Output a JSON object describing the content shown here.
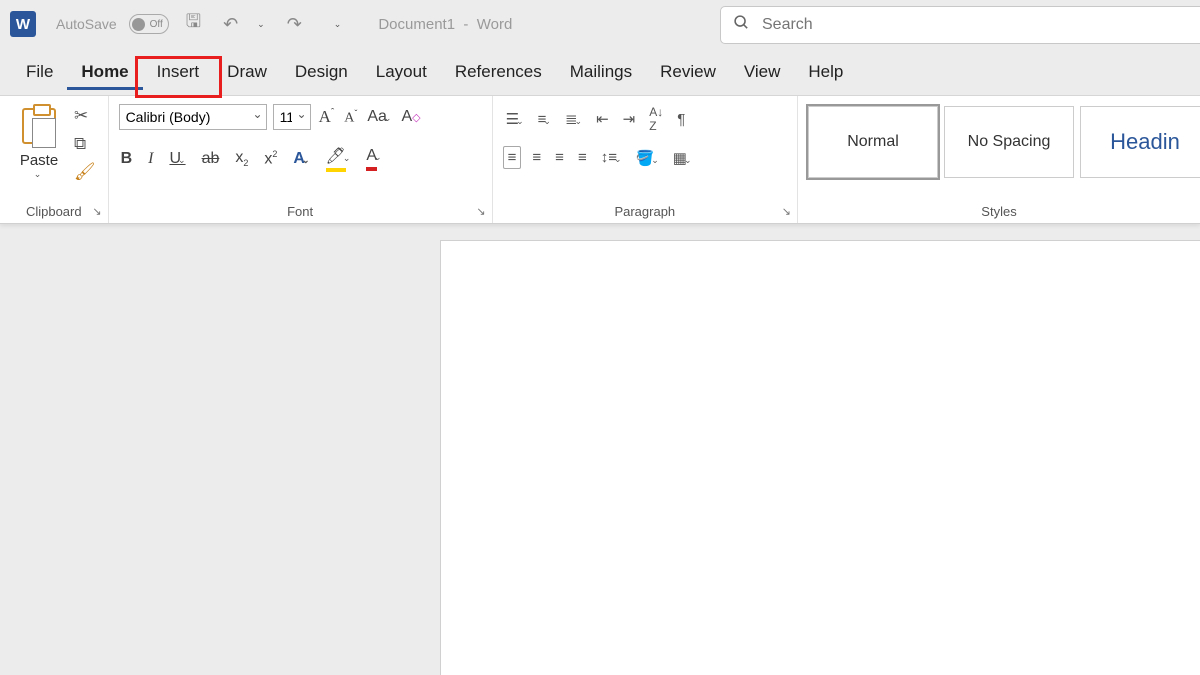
{
  "title": {
    "autosave": "AutoSave",
    "autosave_state": "Off",
    "doc": "Document1",
    "sep": "-",
    "app": "Word"
  },
  "search": {
    "placeholder": "Search"
  },
  "tabs": [
    "File",
    "Home",
    "Insert",
    "Draw",
    "Design",
    "Layout",
    "References",
    "Mailings",
    "Review",
    "View",
    "Help"
  ],
  "active_tab": "Home",
  "highlighted_tab": "Insert",
  "clipboard": {
    "paste": "Paste",
    "paste_chev": "⌄",
    "label": "Clipboard"
  },
  "font": {
    "name": "Calibri (Body)",
    "size": "11",
    "label": "Font",
    "bold": "B",
    "italic": "I",
    "underline": "U",
    "strike": "ab",
    "sub": "x",
    "sup": "x",
    "case": "Aa",
    "clear": "A"
  },
  "paragraph": {
    "label": "Paragraph"
  },
  "styles": {
    "label": "Styles",
    "items": [
      "Normal",
      "No Spacing",
      "Headin"
    ]
  }
}
